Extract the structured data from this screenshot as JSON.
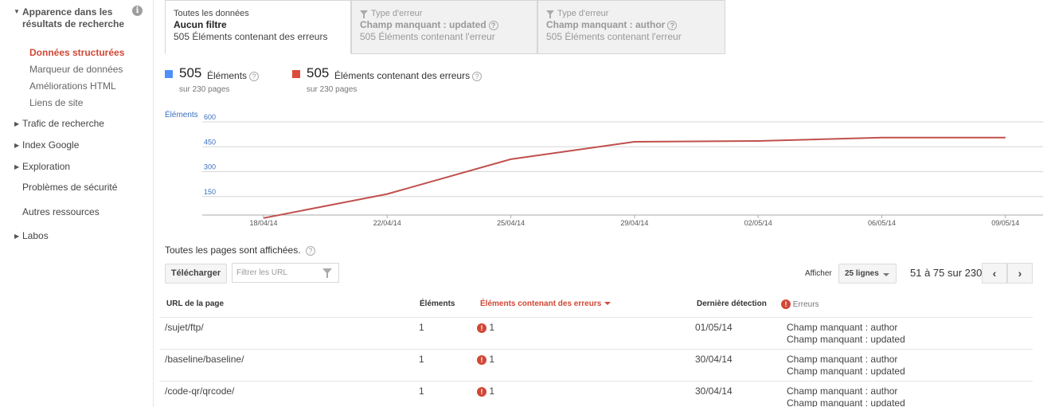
{
  "sidebar": {
    "open_section": "Apparence dans les résultats de recherche",
    "info_icon": "i",
    "sub_items": [
      {
        "label": "Données structurées",
        "active": true
      },
      {
        "label": "Marqueur de données",
        "active": false
      },
      {
        "label": "Améliorations HTML",
        "active": false
      },
      {
        "label": "Liens de site",
        "active": false
      }
    ],
    "sections": [
      {
        "label": "Trafic de recherche",
        "arrow": true
      },
      {
        "label": "Index Google",
        "arrow": true
      },
      {
        "label": "Exploration",
        "arrow": true
      },
      {
        "label": "Problèmes de sécurité",
        "arrow": false
      },
      {
        "label": "Autres ressources",
        "arrow": false
      },
      {
        "label": "Labos",
        "arrow": true
      }
    ]
  },
  "tabs": [
    {
      "line1": "Toutes les données",
      "line2": "Aucun filtre",
      "line3": "505 Éléments contenant des erreurs",
      "active": true
    },
    {
      "line1": "Type d'erreur",
      "line2": "Champ manquant : updated",
      "line3": "505 Éléments contenant l'erreur",
      "active": false
    },
    {
      "line1": "Type d'erreur",
      "line2": "Champ manquant : author",
      "line3": "505 Éléments contenant l'erreur",
      "active": false
    }
  ],
  "legend": [
    {
      "value": "505",
      "label": "Éléments",
      "sub": "sur 230 pages",
      "color": "#4d90fe"
    },
    {
      "value": "505",
      "label": "Éléments contenant des erreurs",
      "sub": "sur 230 pages",
      "color": "#dd4b39"
    }
  ],
  "chart_data": {
    "type": "line",
    "ylabel": "Éléments",
    "ylim": [
      0,
      600
    ],
    "yticks": [
      "600",
      "450",
      "300",
      "150"
    ],
    "xticks": [
      "18/04/14",
      "22/04/14",
      "25/04/14",
      "29/04/14",
      "02/05/14",
      "06/05/14",
      "09/05/14"
    ],
    "series": [
      {
        "color": "#c0504d",
        "points": [
          {
            "x": "18/04/14",
            "y": 20
          },
          {
            "x": "22/04/14",
            "y": 165
          },
          {
            "x": "25/04/14",
            "y": 375
          },
          {
            "x": "29/04/14",
            "y": 480
          },
          {
            "x": "02/05/14",
            "y": 485
          },
          {
            "x": "06/05/14",
            "y": 505
          },
          {
            "x": "09/05/14",
            "y": 505
          }
        ]
      }
    ],
    "grid": true
  },
  "toolbar": {
    "pages_note": "Toutes les pages sont affichées.",
    "download_label": "Télécharger",
    "filter_placeholder": "Filtrer les URL",
    "show_label": "Afficher",
    "rows_select": "25 lignes",
    "range": "51 à 75 sur 230",
    "prev": "‹",
    "next": "›"
  },
  "table": {
    "headers": {
      "url": "URL de la page",
      "items": "Éléments",
      "items_err": "Éléments contenant des erreurs",
      "last_seen": "Dernière détection",
      "errors": "Erreurs"
    },
    "rows": [
      {
        "url": "/sujet/ftp/",
        "items": "1",
        "errors": "1",
        "date": "01/05/14",
        "msg1": "Champ manquant : author",
        "msg2": "Champ manquant : updated"
      },
      {
        "url": "/baseline/baseline/",
        "items": "1",
        "errors": "1",
        "date": "30/04/14",
        "msg1": "Champ manquant : author",
        "msg2": "Champ manquant : updated"
      },
      {
        "url": "/code-qr/qrcode/",
        "items": "1",
        "errors": "1",
        "date": "30/04/14",
        "msg1": "Champ manquant : author",
        "msg2": "Champ manquant : updated"
      }
    ]
  }
}
